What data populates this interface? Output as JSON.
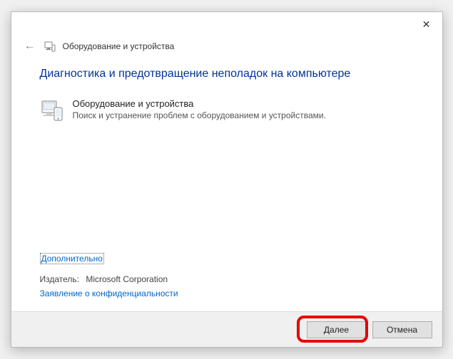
{
  "titlebar": {
    "close_label": "✕"
  },
  "header": {
    "back_glyph": "←",
    "title": "Оборудование и устройства"
  },
  "main": {
    "heading": "Диагностика и предотвращение неполадок на компьютере",
    "item": {
      "title": "Оборудование и устройства",
      "description": "Поиск и устранение проблем с оборудованием и устройствами."
    },
    "advanced_link": "Дополнительно",
    "publisher_label": "Издатель:",
    "publisher_value": "Microsoft Corporation",
    "privacy_link": "Заявление о конфиденциальности"
  },
  "footer": {
    "next_label": "Далее",
    "cancel_label": "Отмена"
  }
}
